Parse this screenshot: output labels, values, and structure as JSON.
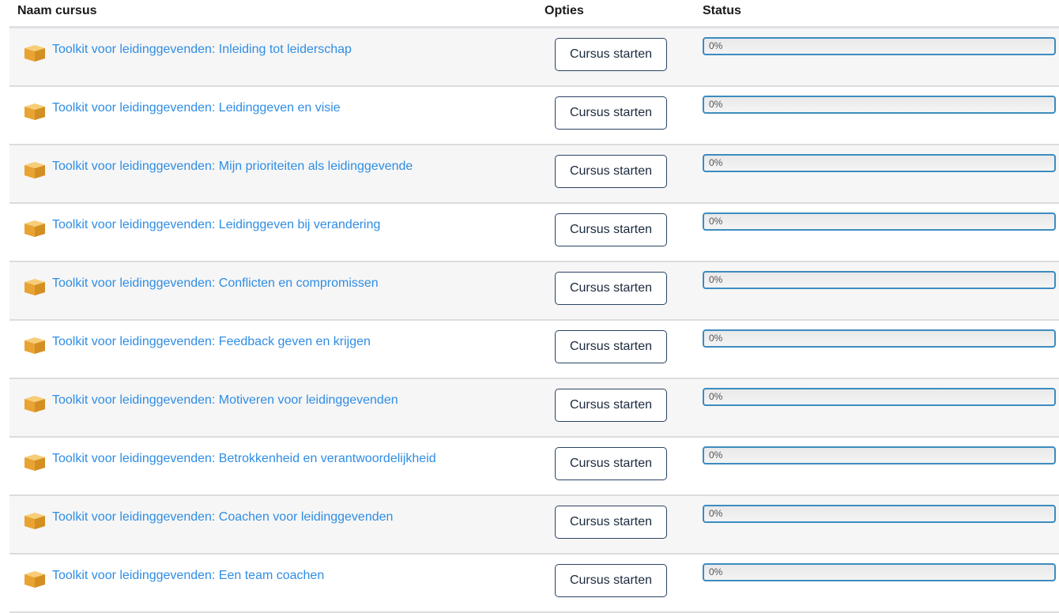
{
  "table": {
    "headers": {
      "name": "Naam cursus",
      "options": "Opties",
      "status": "Status"
    },
    "icon": "course-package-icon",
    "rows": [
      {
        "title": "Toolkit voor leidinggevenden: Inleiding tot leiderschap",
        "button": "Cursus starten",
        "progress": 0,
        "progress_label": "0%"
      },
      {
        "title": "Toolkit voor leidinggevenden: Leidinggeven en visie",
        "button": "Cursus starten",
        "progress": 0,
        "progress_label": "0%"
      },
      {
        "title": "Toolkit voor leidinggevenden: Mijn prioriteiten als leidinggevende",
        "button": "Cursus starten",
        "progress": 0,
        "progress_label": "0%"
      },
      {
        "title": "Toolkit voor leidinggevenden: Leidinggeven bij verandering",
        "button": "Cursus starten",
        "progress": 0,
        "progress_label": "0%"
      },
      {
        "title": "Toolkit voor leidinggevenden: Conflicten en compromissen",
        "button": "Cursus starten",
        "progress": 0,
        "progress_label": "0%"
      },
      {
        "title": "Toolkit voor leidinggevenden: Feedback geven en krijgen",
        "button": "Cursus starten",
        "progress": 0,
        "progress_label": "0%"
      },
      {
        "title": "Toolkit voor leidinggevenden: Motiveren voor leidinggevenden",
        "button": "Cursus starten",
        "progress": 0,
        "progress_label": "0%"
      },
      {
        "title": "Toolkit voor leidinggevenden: Betrokkenheid en verantwoordelijkheid",
        "button": "Cursus starten",
        "progress": 0,
        "progress_label": "0%"
      },
      {
        "title": "Toolkit voor leidinggevenden: Coachen voor leidinggevenden",
        "button": "Cursus starten",
        "progress": 0,
        "progress_label": "0%"
      },
      {
        "title": "Toolkit voor leidinggevenden: Een team coachen",
        "button": "Cursus starten",
        "progress": 0,
        "progress_label": "0%"
      }
    ]
  },
  "colors": {
    "link": "#2f8de4",
    "button_border": "#2a4363",
    "progress_border": "#3c8cc0",
    "icon_fill": "#f0b548"
  }
}
